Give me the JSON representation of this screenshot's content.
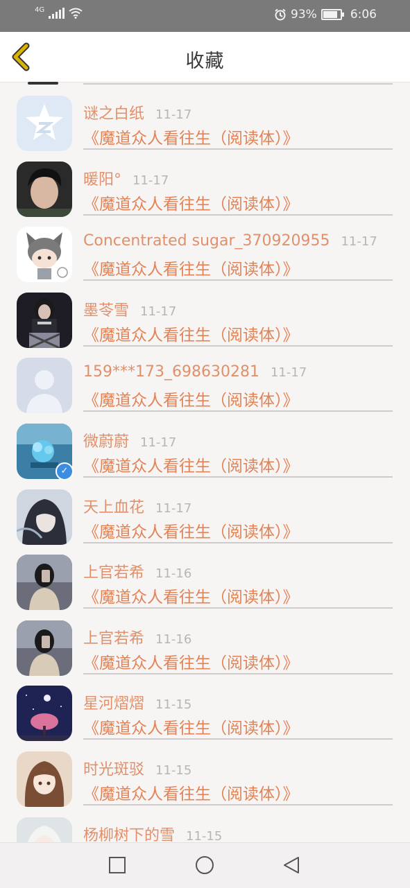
{
  "status_bar": {
    "network": "4G",
    "battery": "93%",
    "battery_level": 0.93,
    "time": "6:06"
  },
  "header": {
    "title": "收藏"
  },
  "favorites": [
    {
      "name": "谜之白纸",
      "date": "11-17",
      "book": "《魔道众人看往生（阅读体）》",
      "avatar": "star-app-avatar"
    },
    {
      "name": "暖阳°",
      "date": "11-17",
      "book": "《魔道众人看往生（阅读体）》",
      "avatar": "boy-photo-avatar"
    },
    {
      "name": "Concentrated sugar_370920955",
      "date": "11-17",
      "book": "《魔道众人看往生（阅读体）》",
      "avatar": "cat-girl-avatar"
    },
    {
      "name": "墨苓雪",
      "date": "11-17",
      "book": "《魔道众人看往生（阅读体）》",
      "avatar": "girl-photo-avatar"
    },
    {
      "name": "159***173_698630281",
      "date": "11-17",
      "book": "《魔道众人看往生（阅读体）》",
      "avatar": "default-user-avatar"
    },
    {
      "name": "微蔚蔚",
      "date": "11-17",
      "book": "《魔道众人看往生（阅读体）》",
      "avatar": "blue-flower-avatar",
      "verified": true
    },
    {
      "name": "天上血花",
      "date": "11-17",
      "book": "《魔道众人看往生（阅读体）》",
      "avatar": "anime-girl-avatar"
    },
    {
      "name": "上官若希",
      "date": "11-16",
      "book": "《魔道众人看往生（阅读体）》",
      "avatar": "mirror-selfie-avatar"
    },
    {
      "name": "上官若希",
      "date": "11-16",
      "book": "《魔道众人看往生（阅读体）》",
      "avatar": "mirror-selfie-avatar"
    },
    {
      "name": "星河熠熠",
      "date": "11-15",
      "book": "《魔道众人看往生（阅读体）》",
      "avatar": "night-tree-avatar"
    },
    {
      "name": "时光斑驳",
      "date": "11-15",
      "book": "《魔道众人看往生（阅读体）》",
      "avatar": "anime-brown-hair-avatar"
    },
    {
      "name": "杨柳树下的雪",
      "date": "11-15",
      "book": "",
      "avatar": "white-hair-avatar"
    }
  ],
  "colors": {
    "accent": "#e38355",
    "name": "#e0906a",
    "date": "#b9b5b5",
    "back_icon": "#d9b300"
  }
}
